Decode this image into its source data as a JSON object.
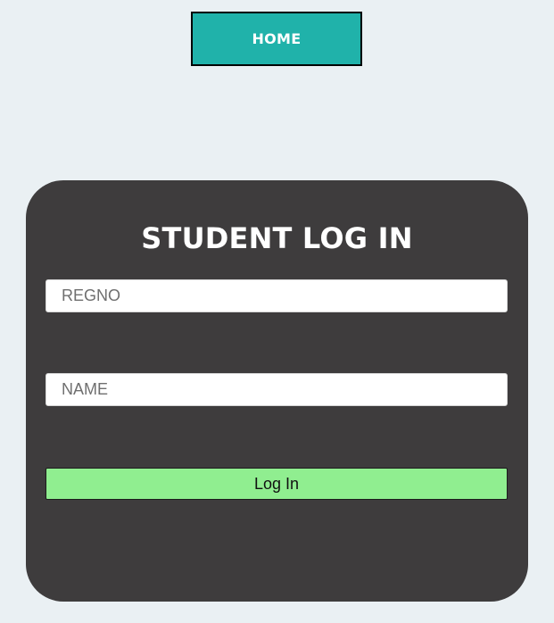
{
  "nav": {
    "home_label": "HOME"
  },
  "login_form": {
    "title": "STUDENT LOG IN",
    "regno_placeholder": "REGNO",
    "regno_value": "",
    "name_placeholder": "NAME",
    "name_value": "",
    "submit_label": "Log In"
  },
  "colors": {
    "page_background": "#eaf0f3",
    "home_button": "#20b2aa",
    "card_background": "#3e3c3d",
    "submit_button": "#90ee90"
  }
}
